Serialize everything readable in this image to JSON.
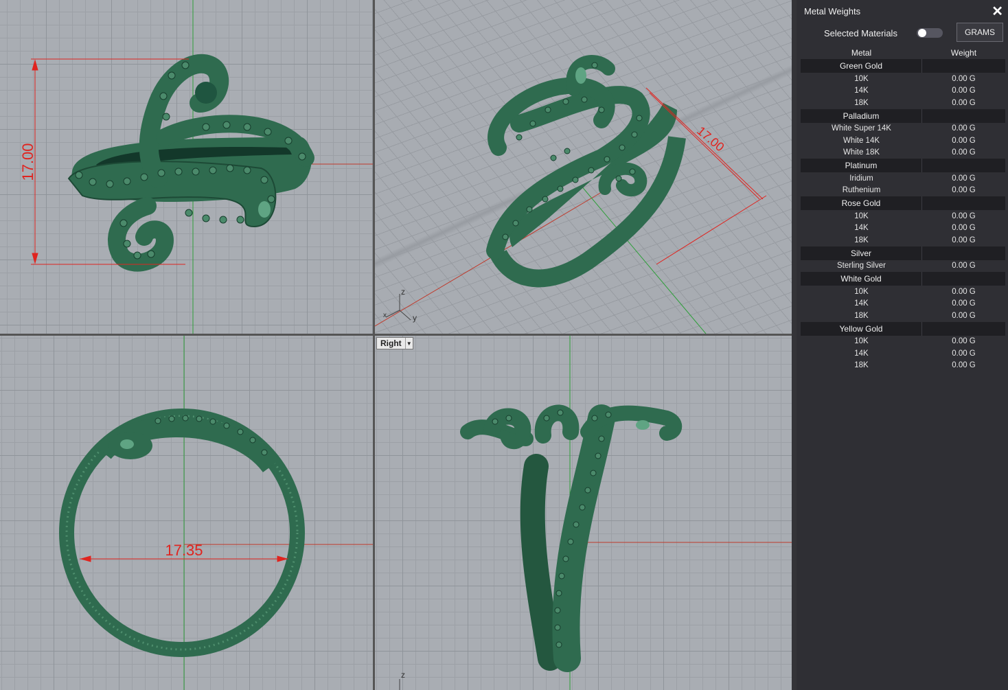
{
  "panel": {
    "title": "Metal Weights",
    "close_icon": "close-icon",
    "selected_materials_label": "Selected Materials",
    "selected_materials_enabled": false,
    "units_button": "GRAMS",
    "columns": [
      "Metal",
      "Weight"
    ],
    "groups": [
      {
        "name": "Green Gold",
        "rows": [
          {
            "metal": "10K",
            "weight": "0.00 G"
          },
          {
            "metal": "14K",
            "weight": "0.00 G"
          },
          {
            "metal": "18K",
            "weight": "0.00 G"
          }
        ]
      },
      {
        "name": "Palladium",
        "rows": [
          {
            "metal": "White Super 14K",
            "weight": "0.00 G"
          },
          {
            "metal": "White 14K",
            "weight": "0.00 G"
          },
          {
            "metal": "White 18K",
            "weight": "0.00 G"
          }
        ]
      },
      {
        "name": "Platinum",
        "rows": [
          {
            "metal": "Iridium",
            "weight": "0.00 G"
          },
          {
            "metal": "Ruthenium",
            "weight": "0.00 G"
          }
        ]
      },
      {
        "name": "Rose Gold",
        "rows": [
          {
            "metal": "10K",
            "weight": "0.00 G"
          },
          {
            "metal": "14K",
            "weight": "0.00 G"
          },
          {
            "metal": "18K",
            "weight": "0.00 G"
          }
        ]
      },
      {
        "name": "Silver",
        "rows": [
          {
            "metal": "Sterling Silver",
            "weight": "0.00 G"
          }
        ]
      },
      {
        "name": "White Gold",
        "rows": [
          {
            "metal": "10K",
            "weight": "0.00 G"
          },
          {
            "metal": "14K",
            "weight": "0.00 G"
          },
          {
            "metal": "18K",
            "weight": "0.00 G"
          }
        ]
      },
      {
        "name": "Yellow Gold",
        "rows": [
          {
            "metal": "10K",
            "weight": "0.00 G"
          },
          {
            "metal": "14K",
            "weight": "0.00 G"
          },
          {
            "metal": "18K",
            "weight": "0.00 G"
          }
        ]
      }
    ]
  },
  "viewports": {
    "top": {
      "dimension": "17.00"
    },
    "perspective": {
      "dimension": "17.00",
      "axis_z": "z",
      "axis_y": "y",
      "axis_x": "x"
    },
    "front": {
      "dimension": "17.35"
    },
    "right": {
      "label": "Right",
      "axis_z": "z"
    }
  },
  "colors": {
    "model": "#2f6b4f",
    "dimension": "#e0241f",
    "x_axis": "#c0392b",
    "y_axis": "#2e9e3a"
  }
}
